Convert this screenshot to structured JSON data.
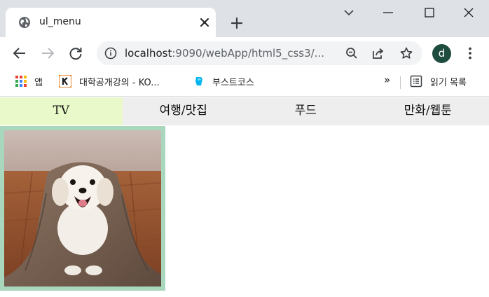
{
  "browser": {
    "tab_title": "ul_menu",
    "url_host": "localhost",
    "url_rest": ":9090/webApp/html5_css3/...",
    "avatar_letter": "d",
    "accent": "#1e4d40"
  },
  "bookmarks": {
    "apps_label": "앱",
    "item1_label": "대학공개강의 - KO...",
    "item2_label": "부스트코스",
    "overflow": "»",
    "reading_list": "읽기 목록"
  },
  "menu": {
    "items": [
      {
        "label": "TV"
      },
      {
        "label": "여행/맛집"
      },
      {
        "label": "푸드"
      },
      {
        "label": "만화/웹툰"
      }
    ],
    "active_bg": "#e9f9c9",
    "bg": "#eeeeee"
  },
  "image": {
    "frame_color": "#a9d7bd",
    "subject": "dog-photo"
  }
}
